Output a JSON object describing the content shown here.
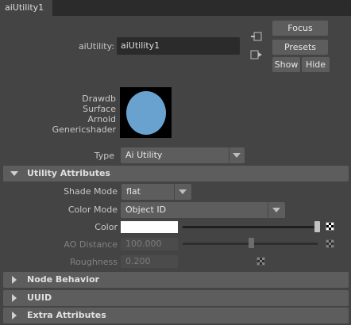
{
  "tab": {
    "title": "aiUtility1"
  },
  "header": {
    "node_type_label": "aiUtility:",
    "node_name": "aiUtility1",
    "buttons": {
      "focus": "Focus",
      "presets": "Presets",
      "show": "Show",
      "hide": "Hide"
    }
  },
  "swatch": {
    "classification": [
      "Drawdb",
      "Surface",
      "Arnold",
      "Genericshader"
    ],
    "ball_color": "#6aa2cf"
  },
  "type_row": {
    "label": "Type",
    "value": "Ai Utility"
  },
  "sections": {
    "utility": {
      "title": "Utility Attributes",
      "expanded": true,
      "shade_mode": {
        "label": "Shade Mode",
        "value": "flat"
      },
      "color_mode": {
        "label": "Color Mode",
        "value": "Object ID"
      },
      "color": {
        "label": "Color",
        "value": "#ffffff",
        "slider": 1.0
      },
      "ao_distance": {
        "label": "AO Distance",
        "value": "100.000",
        "enabled": false,
        "slider": 0.5
      },
      "roughness": {
        "label": "Roughness",
        "value": "0.200",
        "enabled": false
      }
    },
    "node_behavior": {
      "title": "Node Behavior",
      "expanded": false
    },
    "uuid": {
      "title": "UUID",
      "expanded": false
    },
    "extra": {
      "title": "Extra Attributes",
      "expanded": false
    }
  }
}
